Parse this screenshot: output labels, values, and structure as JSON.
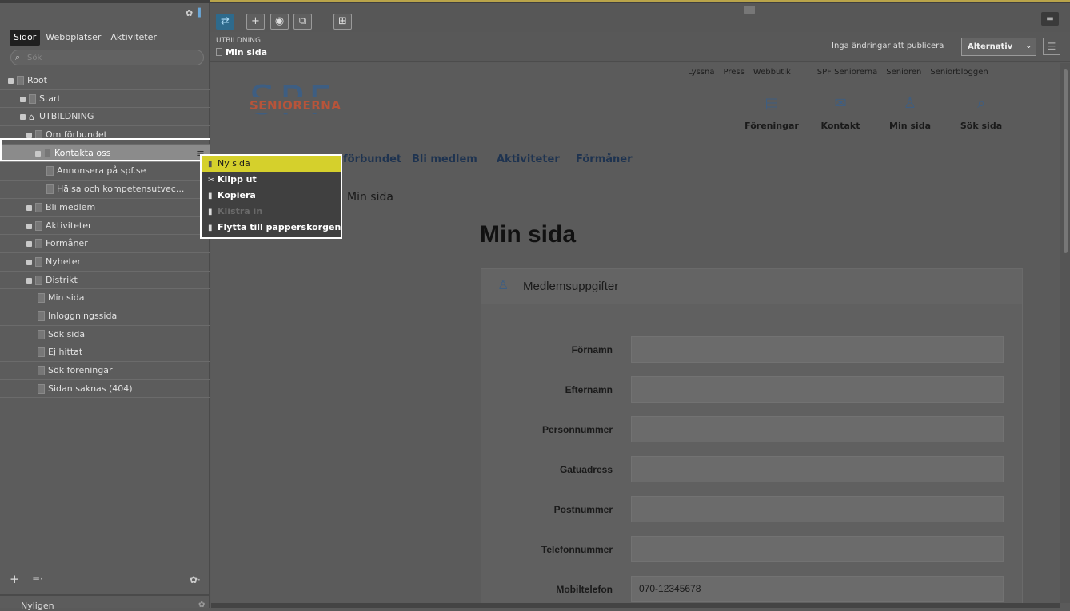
{
  "left_panel": {
    "tabs": [
      "Sidor",
      "Webbplatser",
      "Aktiviteter"
    ],
    "search_placeholder": "Sök",
    "tree": [
      {
        "label": "Root",
        "indent": 0,
        "expander": true,
        "icon": "page"
      },
      {
        "label": "Start",
        "indent": 1,
        "expander": true,
        "icon": "page"
      },
      {
        "label": "UTBILDNING",
        "indent": 1,
        "expander": true,
        "icon": "home"
      },
      {
        "label": "Om förbundet",
        "indent": 2,
        "expander": true,
        "icon": "page"
      },
      {
        "label": "Kontakta oss",
        "indent": 3,
        "expander": true,
        "icon": "page",
        "selected": true
      },
      {
        "label": "Annonsera på spf.se",
        "indent": 4,
        "expander": false,
        "icon": "page"
      },
      {
        "label": "Hälsa och kompetensutvec...",
        "indent": 4,
        "expander": false,
        "icon": "page"
      },
      {
        "label": "Bli medlem",
        "indent": 2,
        "expander": true,
        "icon": "page"
      },
      {
        "label": "Aktiviteter",
        "indent": 2,
        "expander": true,
        "icon": "page"
      },
      {
        "label": "Förmåner",
        "indent": 2,
        "expander": true,
        "icon": "page"
      },
      {
        "label": "Nyheter",
        "indent": 2,
        "expander": true,
        "icon": "page"
      },
      {
        "label": "Distrikt",
        "indent": 2,
        "expander": true,
        "icon": "page"
      },
      {
        "label": "Min sida",
        "indent": 3,
        "expander": false,
        "icon": "page"
      },
      {
        "label": "Inloggningssida",
        "indent": 3,
        "expander": false,
        "icon": "page"
      },
      {
        "label": "Sök sida",
        "indent": 3,
        "expander": false,
        "icon": "page"
      },
      {
        "label": "Ej hittat",
        "indent": 3,
        "expander": false,
        "icon": "page"
      },
      {
        "label": "Sök föreningar",
        "indent": 3,
        "expander": false,
        "icon": "page"
      },
      {
        "label": "Sidan saknas (404)",
        "indent": 3,
        "expander": false,
        "icon": "page"
      }
    ],
    "recent_label": "Nyligen"
  },
  "context_menu": {
    "items": [
      {
        "label": "Ny sida",
        "icon": "new-page-icon",
        "state": "highlighted"
      },
      {
        "label": "Klipp ut",
        "icon": "scissors-icon",
        "state": "normal"
      },
      {
        "label": "Kopiera",
        "icon": "copy-icon",
        "state": "normal"
      },
      {
        "label": "Klistra in",
        "icon": "paste-icon",
        "state": "disabled"
      },
      {
        "label": "Flytta till papperskorgen",
        "icon": "trash-icon",
        "state": "normal"
      }
    ]
  },
  "toolbar": {
    "breadcrumb_parent": "UTBILDNING",
    "breadcrumb_current": "Min sida",
    "publish_status": "Inga ändringar att publicera",
    "options_label": "Alternativ"
  },
  "site": {
    "logo_big": "SPF",
    "logo_small": "SENIORERNA",
    "top_links": [
      "Lyssna",
      "Press",
      "Webbutik",
      "SPF Seniorerna",
      "Senioren",
      "Seniorbloggen"
    ],
    "icon_links": [
      {
        "label": "Föreningar",
        "icon": "list-icon"
      },
      {
        "label": "Kontakt",
        "icon": "mail-icon"
      },
      {
        "label": "Min sida",
        "icon": "user-icon"
      },
      {
        "label": "Sök sida",
        "icon": "search-icon"
      }
    ],
    "nav": [
      "förbundet",
      "Bli medlem",
      "Aktiviteter",
      "Förmåner"
    ],
    "breadcrumb": "Min sida",
    "heading": "Min sida",
    "card_title": "Medlemsuppgifter",
    "fields": [
      {
        "label": "Förnamn",
        "value": ""
      },
      {
        "label": "Efternamn",
        "value": ""
      },
      {
        "label": "Personnummer",
        "value": ""
      },
      {
        "label": "Gatuadress",
        "value": ""
      },
      {
        "label": "Postnummer",
        "value": ""
      },
      {
        "label": "Telefonnummer",
        "value": ""
      },
      {
        "label": "Mobiltelefon",
        "value": "070-12345678"
      }
    ]
  }
}
